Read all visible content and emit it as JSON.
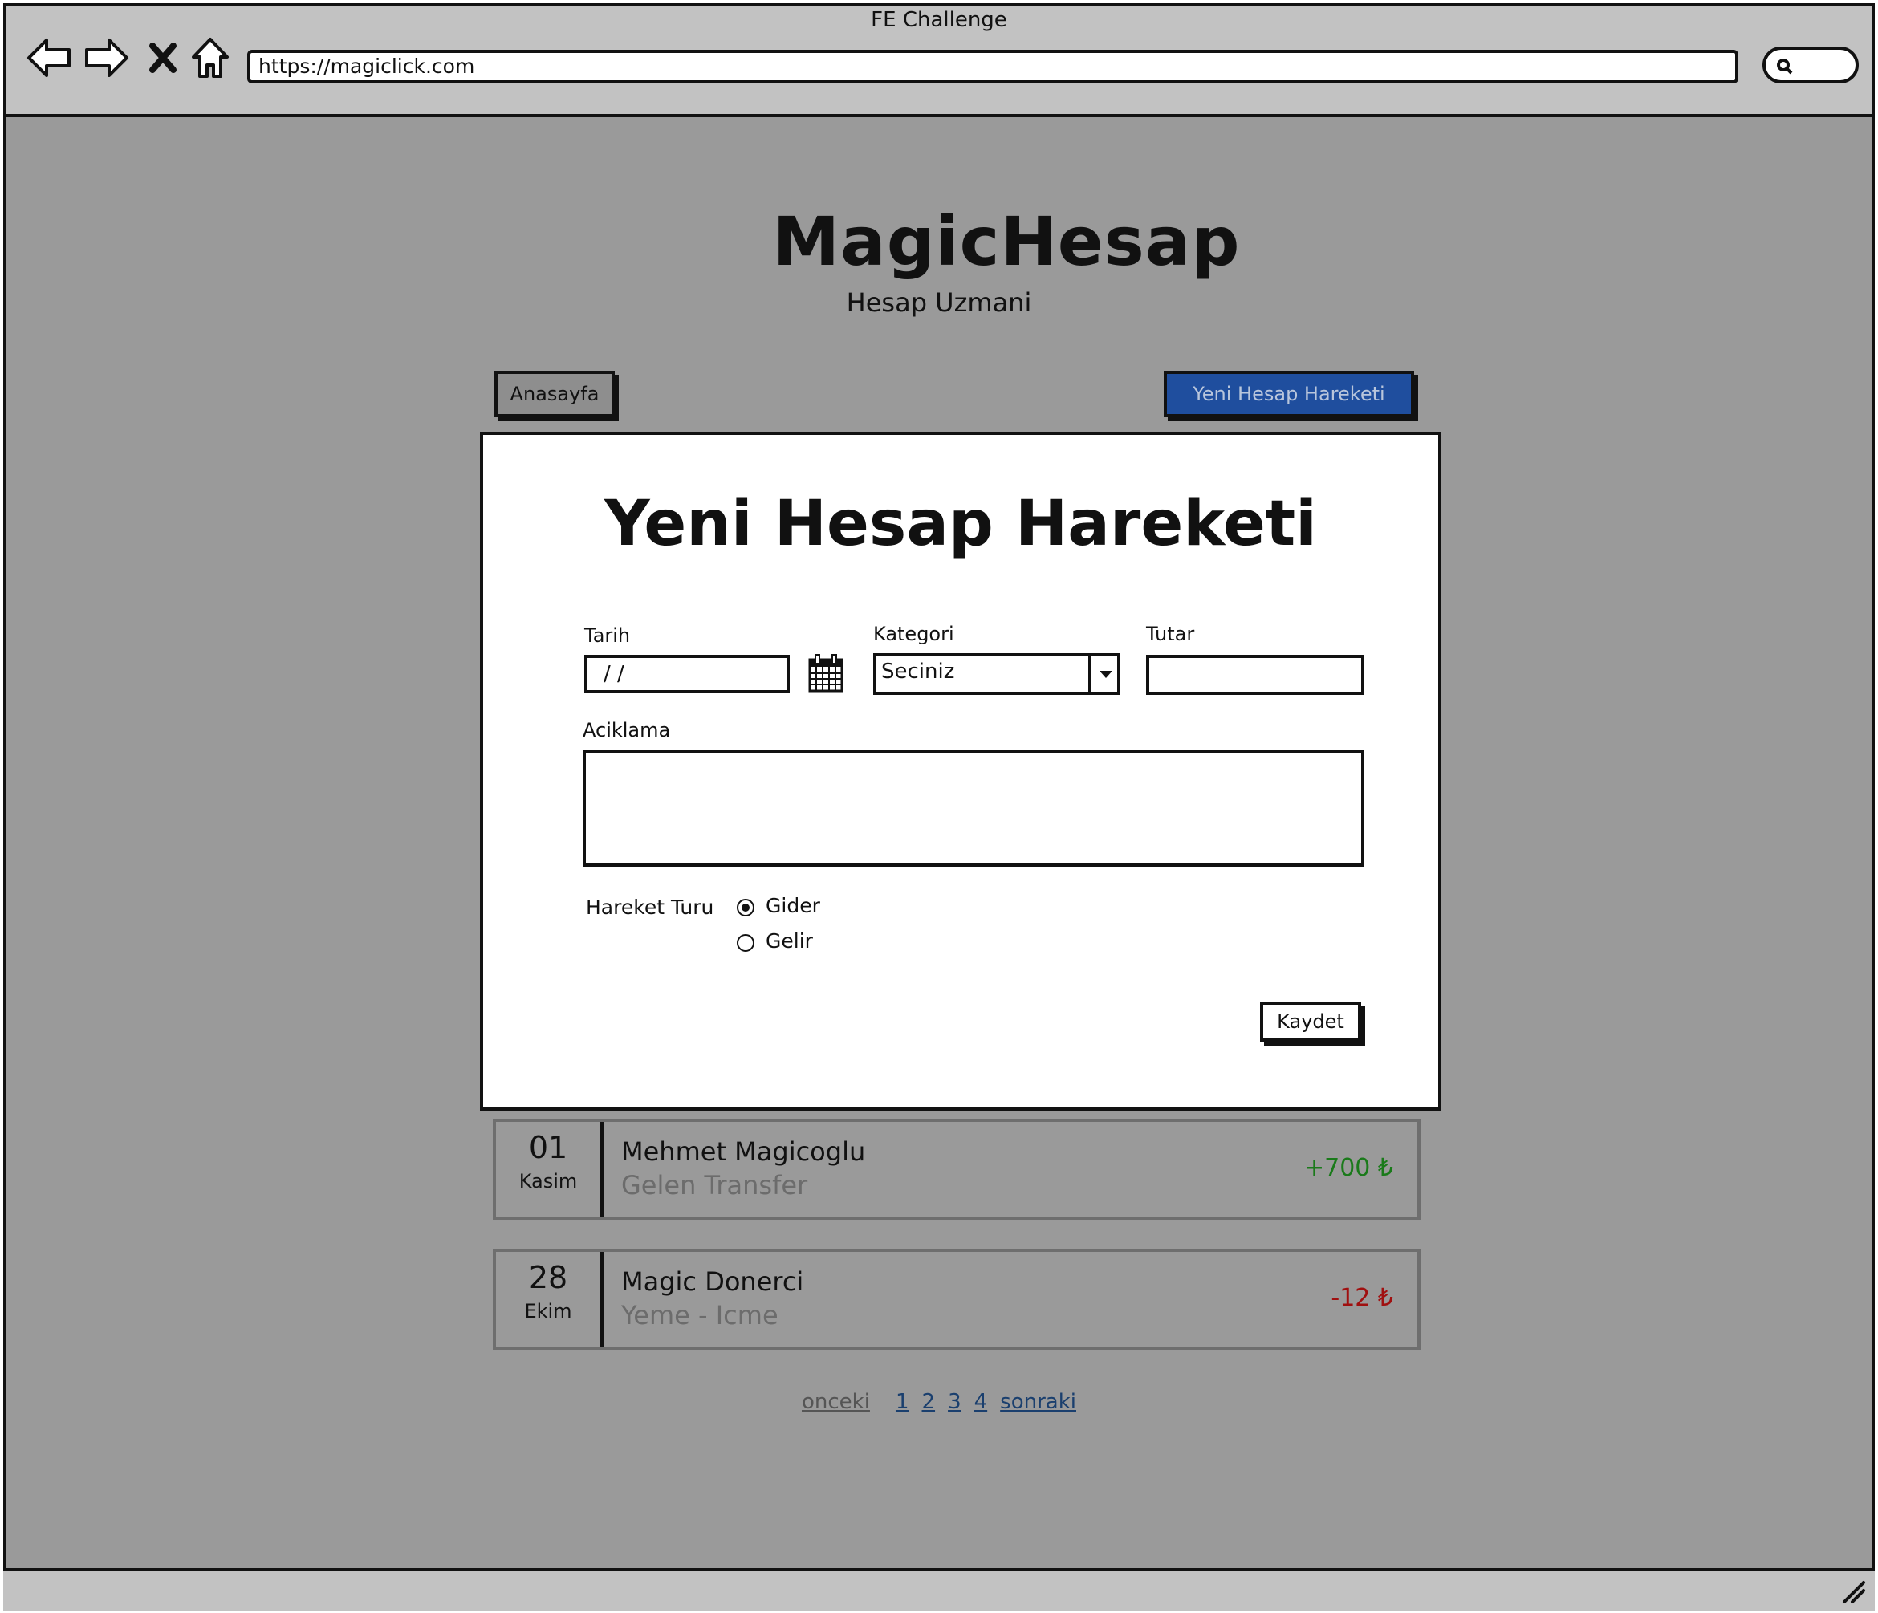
{
  "window": {
    "title": "FE Challenge",
    "url": "https://magiclick.com"
  },
  "app": {
    "title": "MagicHesap",
    "subtitle": "Hesap Uzmani"
  },
  "nav": {
    "home_label": "Anasayfa",
    "new_label": "Yeni Hesap Hareketi"
  },
  "form": {
    "title": "Yeni Hesap Hareketi",
    "tarih_label": "Tarih",
    "tarih_value": "/  /",
    "kategori_label": "Kategori",
    "kategori_value": "Seciniz",
    "tutar_label": "Tutar",
    "tutar_value": "",
    "aciklama_label": "Aciklama",
    "aciklama_value": "",
    "hareket_label": "Hareket Turu",
    "options": [
      {
        "label": "Gider",
        "selected": true
      },
      {
        "label": "Gelir",
        "selected": false
      }
    ],
    "save_label": "Kaydet"
  },
  "transactions": [
    {
      "day": "01",
      "month": "Kasim",
      "name": "Mehmet Magicoglu",
      "category": "Gelen Transfer",
      "amount": "+700 ₺",
      "color": "#1a7a1a"
    },
    {
      "day": "28",
      "month": "Ekim",
      "name": "Magic Donerci",
      "category": "Yeme - Icme",
      "amount": "-12 ₺",
      "color": "#a01010"
    }
  ],
  "pagination": {
    "prev": "onceki",
    "pages": [
      "1",
      "2",
      "3",
      "4"
    ],
    "next": "sonraki"
  },
  "icons": [
    "back-arrow-icon",
    "forward-arrow-icon",
    "stop-icon",
    "home-icon",
    "search-icon",
    "calendar-icon",
    "chevron-down-icon",
    "resize-grip-icon"
  ],
  "colors": {
    "accent": "#1f4e9e",
    "page_bg": "#9a9a9a",
    "chrome_bg": "#c2c2c2",
    "income": "#1a7a1a",
    "expense": "#a01010"
  }
}
